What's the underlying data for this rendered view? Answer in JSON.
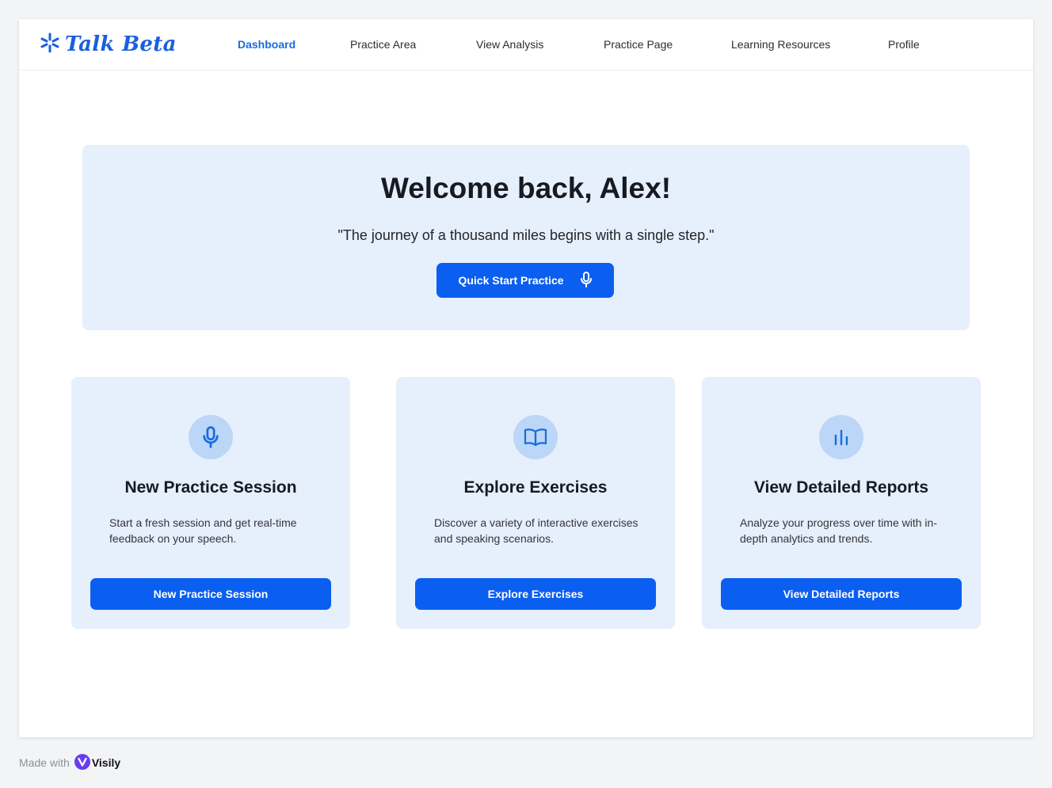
{
  "header": {
    "logo_text": "Talk Beta",
    "nav": [
      {
        "label": "Dashboard",
        "active": true
      },
      {
        "label": "Practice Area",
        "active": false
      },
      {
        "label": "View Analysis",
        "active": false
      },
      {
        "label": "Practice Page",
        "active": false
      },
      {
        "label": "Learning Resources",
        "active": false
      },
      {
        "label": "Profile",
        "active": false
      }
    ]
  },
  "hero": {
    "title": "Welcome back, Alex!",
    "quote": "\"The journey of a thousand miles begins with a single step.\"",
    "button_label": "Quick Start Practice",
    "button_icon": "microphone-icon"
  },
  "cards": [
    {
      "icon": "microphone-icon",
      "title": "New Practice Session",
      "description": "Start a fresh session and get real-time feedback on your speech.",
      "button_label": "New Practice Session"
    },
    {
      "icon": "book-icon",
      "title": "Explore Exercises",
      "description": "Discover a variety of interactive exercises and speaking scenarios.",
      "button_label": "Explore Exercises"
    },
    {
      "icon": "bar-chart-icon",
      "title": "View Detailed Reports",
      "description": "Analyze your progress over time with in-depth analytics and trends.",
      "button_label": "View Detailed Reports"
    }
  ],
  "footer": {
    "made_with": "Made with",
    "brand": "Visily"
  },
  "colors": {
    "primary": "#0b5ff0",
    "nav_active": "#1a6be0",
    "card_bg": "#e6effc",
    "icon_circle": "#bcd6f7"
  }
}
